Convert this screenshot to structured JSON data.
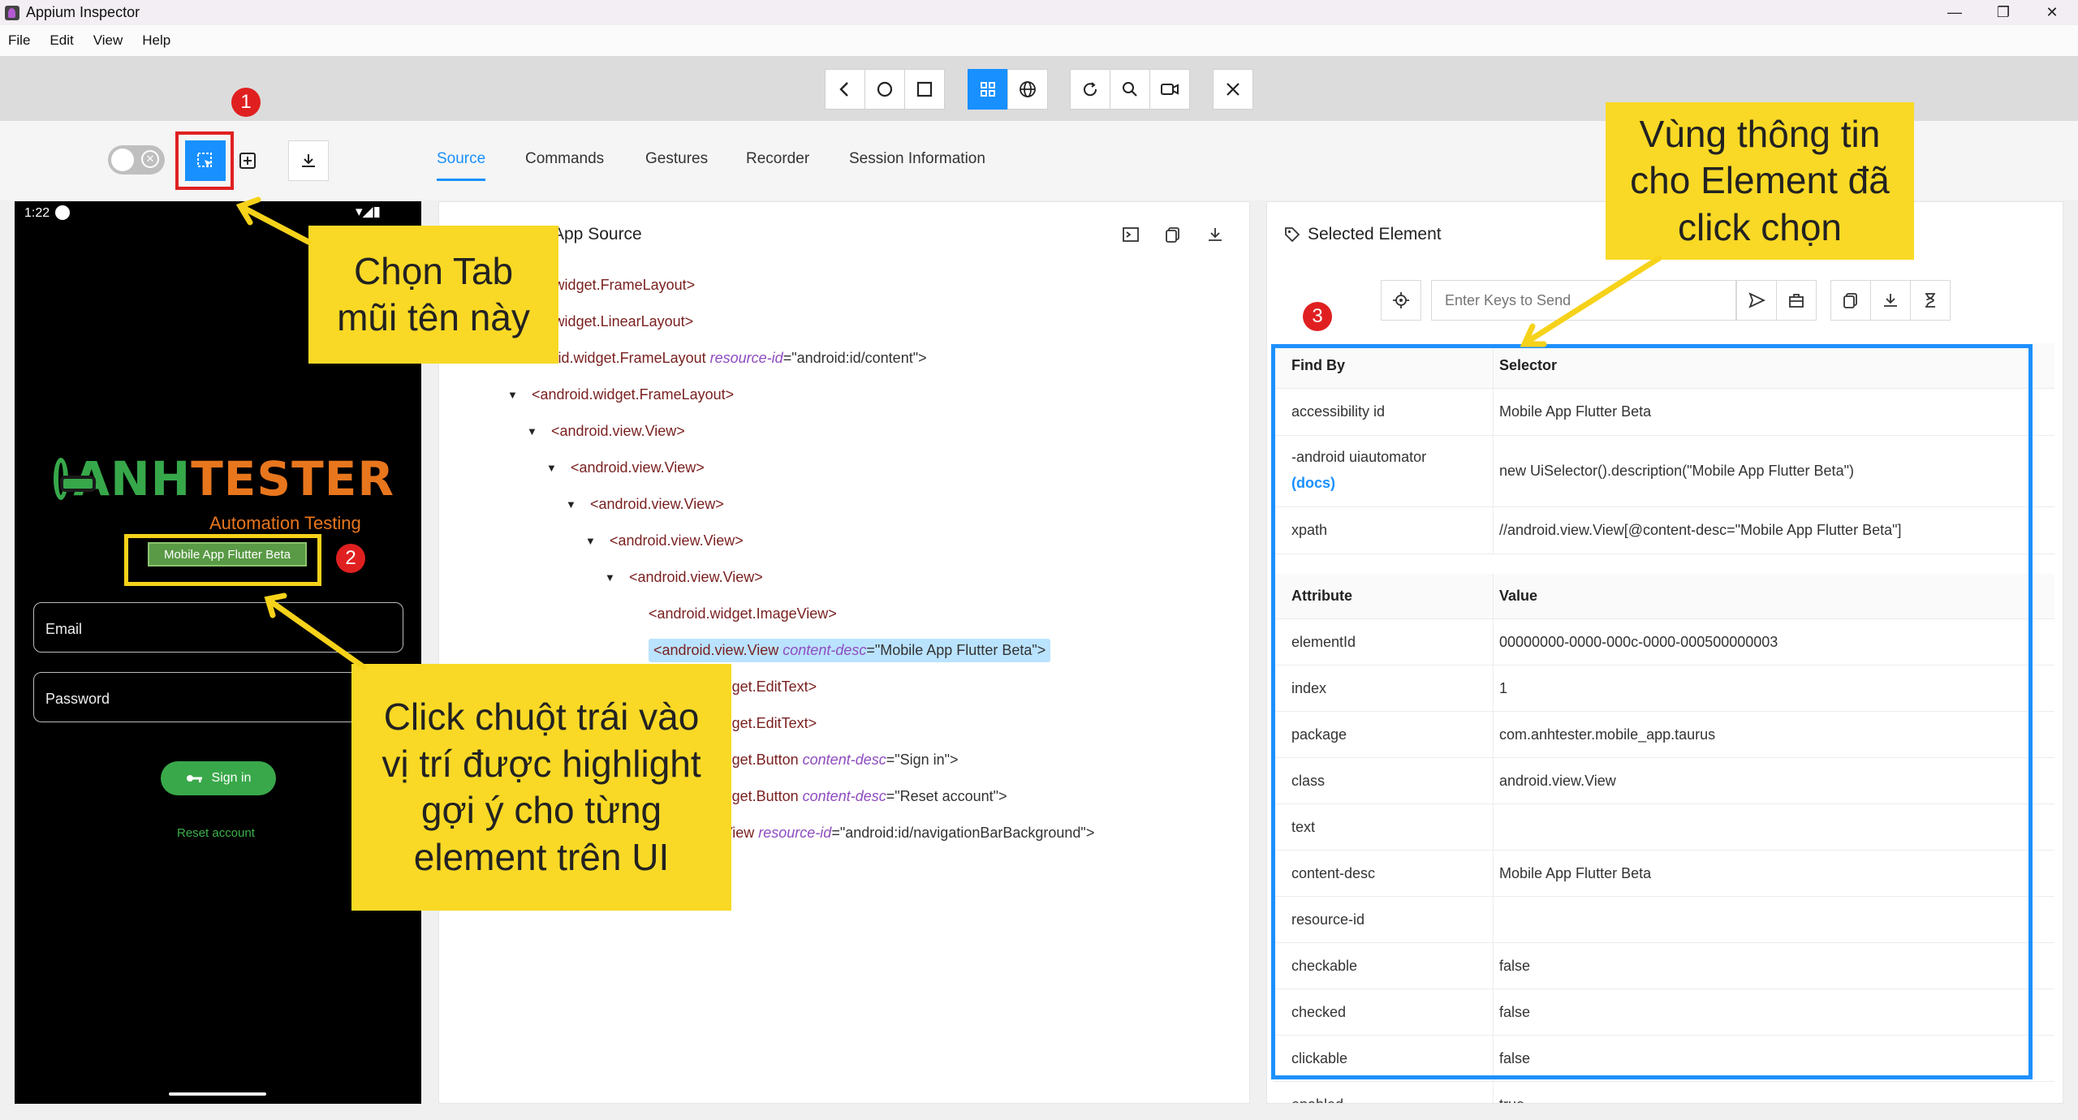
{
  "window": {
    "title": "Appium Inspector",
    "minimize": "—",
    "maximize": "❐",
    "close": "✕"
  },
  "menu": [
    "File",
    "Edit",
    "View",
    "Help"
  ],
  "tabs": [
    "Source",
    "Commands",
    "Gestures",
    "Recorder",
    "Session Information"
  ],
  "device": {
    "time": "1:22",
    "logo_prefix": "ANH",
    "logo_suffix": "TESTER",
    "logo_subtitle": "Automation Testing",
    "highlight_text": "Mobile App Flutter Beta",
    "email_label": "Email",
    "password_label": "Password",
    "signin_label": "Sign in",
    "reset_label": "Reset account",
    "colors": {
      "green": "#37a84a",
      "orange": "#e8761d"
    }
  },
  "source": {
    "title": "App Source",
    "nodes": [
      {
        "tag": "<android.widget.FrameLayout>"
      },
      {
        "tag": "<android.widget.LinearLayout>"
      },
      {
        "tag": "<android.widget.FrameLayout",
        "attr": "resource-id",
        "val": "=\"android:id/content\">"
      },
      {
        "tag": "<android.widget.FrameLayout>"
      },
      {
        "tag": "<android.view.View>"
      },
      {
        "tag": "<android.view.View>"
      },
      {
        "tag": "<android.view.View>"
      },
      {
        "tag": "<android.view.View>"
      },
      {
        "tag": "<android.view.View>"
      },
      {
        "tag": "<android.widget.ImageView>"
      },
      {
        "tag": "<android.view.View",
        "attr": "content-desc",
        "val": "=\"Mobile App Flutter Beta\">"
      },
      {
        "tag": "<android.widget.EditText>"
      },
      {
        "tag": "<android.widget.EditText>"
      },
      {
        "tag": "<android.widget.Button",
        "attr": "content-desc",
        "val": "=\"Sign in\">"
      },
      {
        "tag": "<android.widget.Button",
        "attr": "content-desc",
        "val": "=\"Reset account\">"
      },
      {
        "tag": "<android.view.View",
        "attr": "resource-id",
        "val": "=\"android:id/navigationBarBackground\">"
      }
    ]
  },
  "selected": {
    "title": "Selected Element",
    "keys_placeholder": "Enter Keys to Send",
    "find_by_header": {
      "a": "Find By",
      "b": "Selector"
    },
    "find_by": [
      {
        "a": "accessibility id",
        "b": "Mobile App Flutter Beta"
      },
      {
        "a": "-android uiautomator",
        "docs": "(docs)",
        "b": "new UiSelector().description(\"Mobile App Flutter Beta\")"
      },
      {
        "a": "xpath",
        "b": "//android.view.View[@content-desc=\"Mobile App Flutter Beta\"]"
      }
    ],
    "attr_header": {
      "a": "Attribute",
      "b": "Value"
    },
    "attrs": [
      {
        "a": "elementId",
        "b": "00000000-0000-000c-0000-000500000003"
      },
      {
        "a": "index",
        "b": "1"
      },
      {
        "a": "package",
        "b": "com.anhtester.mobile_app.taurus"
      },
      {
        "a": "class",
        "b": "android.view.View"
      },
      {
        "a": "text",
        "b": ""
      },
      {
        "a": "content-desc",
        "b": "Mobile App Flutter Beta"
      },
      {
        "a": "resource-id",
        "b": ""
      },
      {
        "a": "checkable",
        "b": "false"
      },
      {
        "a": "checked",
        "b": "false"
      },
      {
        "a": "clickable",
        "b": "false"
      },
      {
        "a": "enabled",
        "b": "true"
      }
    ]
  },
  "annotations": {
    "callout1": "Chọn Tab\nmũi tên này",
    "callout2": "Click chuột trái vào\nvị trí được highlight\ngợi ý cho từng\nelement trên UI",
    "callout3": "Vùng thông tin\ncho Element đã\nclick chọn",
    "badges": [
      "1",
      "2",
      "3"
    ]
  }
}
